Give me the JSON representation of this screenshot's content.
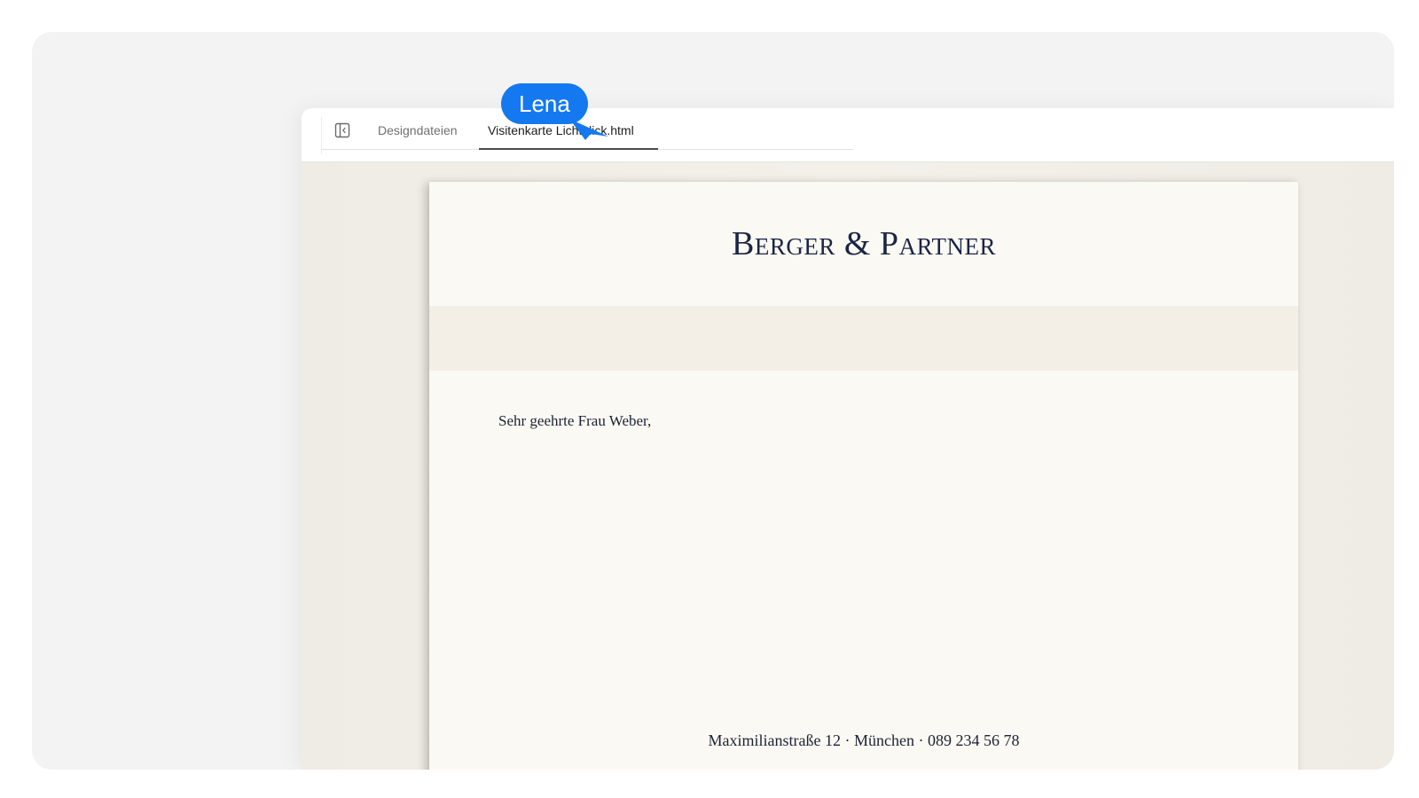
{
  "tabs": [
    {
      "label": "Designdateien",
      "active": false
    },
    {
      "label": "Visitenkarte Lichtblick.html",
      "active": true
    }
  ],
  "icons": {
    "sidebar_toggle": "sidebar-collapse-icon",
    "cursor": "cursor-pointer-icon"
  },
  "document": {
    "letterhead": "Berger & Partner",
    "salutation": "Sehr geehrte Frau Weber,",
    "footer": "Maximilianstraße 12 · München · 089 234 56 78"
  },
  "collaborator": {
    "name": "Lena",
    "color": "#1479f0"
  },
  "colors": {
    "ink": "#1b2545",
    "paper": "#fbf9f3"
  }
}
